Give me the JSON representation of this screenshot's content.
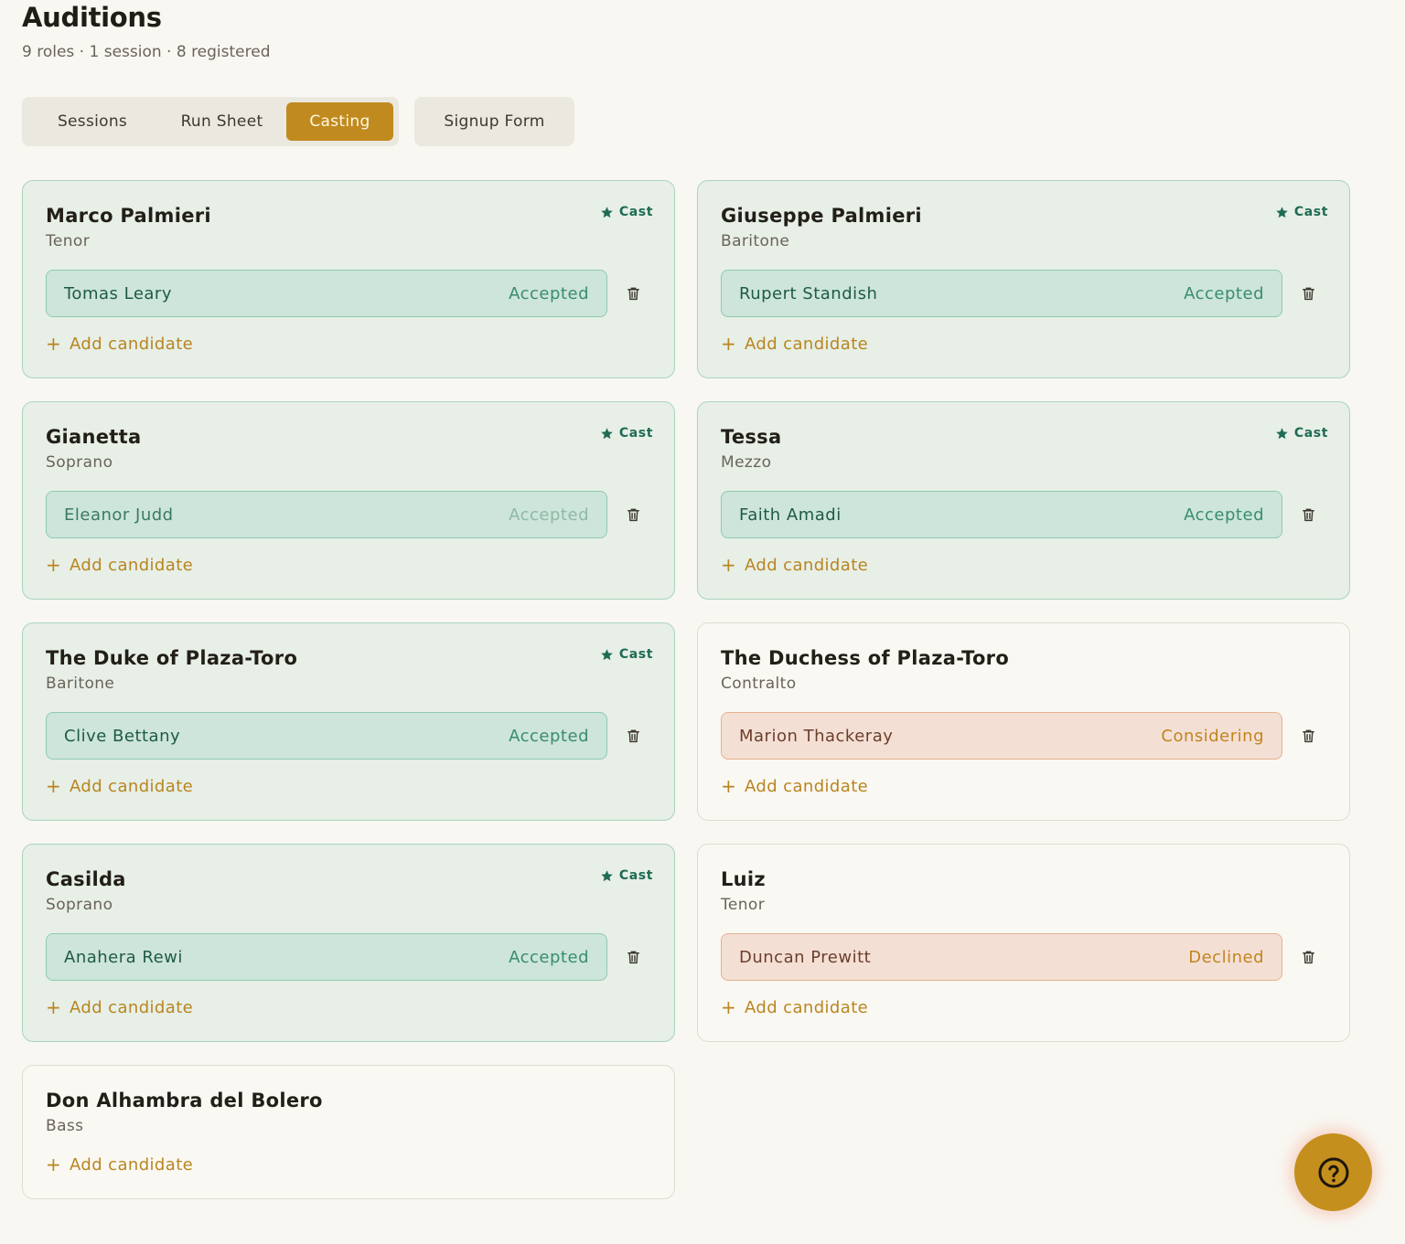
{
  "header": {
    "title": "Auditions",
    "subtitle": "9 roles · 1 session · 8 registered"
  },
  "tabs": [
    {
      "label": "Sessions",
      "active": false
    },
    {
      "label": "Run Sheet",
      "active": false
    },
    {
      "label": "Casting",
      "active": true
    }
  ],
  "signup_label": "Signup Form",
  "add_label": "Add candidate",
  "cast_label": "Cast",
  "roles": [
    {
      "name": "Marco Palmieri",
      "voice": "Tenor",
      "cast": true,
      "candidate": {
        "name": "Tomas Leary",
        "status": "Accepted"
      }
    },
    {
      "name": "Giuseppe Palmieri",
      "voice": "Baritone",
      "cast": true,
      "candidate": {
        "name": "Rupert Standish",
        "status": "Accepted"
      }
    },
    {
      "name": "Gianetta",
      "voice": "Soprano",
      "cast": true,
      "candidate": {
        "name": "Eleanor Judd",
        "status": "Accepted"
      }
    },
    {
      "name": "Tessa",
      "voice": "Mezzo",
      "cast": true,
      "candidate": {
        "name": "Faith Amadi",
        "status": "Accepted"
      }
    },
    {
      "name": "The Duke of Plaza-Toro",
      "voice": "Baritone",
      "cast": true,
      "candidate": {
        "name": "Clive Bettany",
        "status": "Accepted"
      }
    },
    {
      "name": "The Duchess of Plaza-Toro",
      "voice": "Contralto",
      "cast": false,
      "candidate": {
        "name": "Marion Thackeray",
        "status": "Considering"
      }
    },
    {
      "name": "Casilda",
      "voice": "Soprano",
      "cast": true,
      "candidate": {
        "name": "Anahera Rewi",
        "status": "Accepted"
      }
    },
    {
      "name": "Luiz",
      "voice": "Tenor",
      "cast": false,
      "candidate": {
        "name": "Duncan Prewitt",
        "status": "Declined"
      }
    },
    {
      "name": "Don Alhambra del Bolero",
      "voice": "Bass",
      "cast": false,
      "candidate": null
    }
  ],
  "colors": {
    "accent": "#c08a1e",
    "cast_bg": "#e7efe7",
    "accepted_bg": "#cde5da",
    "warm_bg": "#f4dfd5"
  }
}
